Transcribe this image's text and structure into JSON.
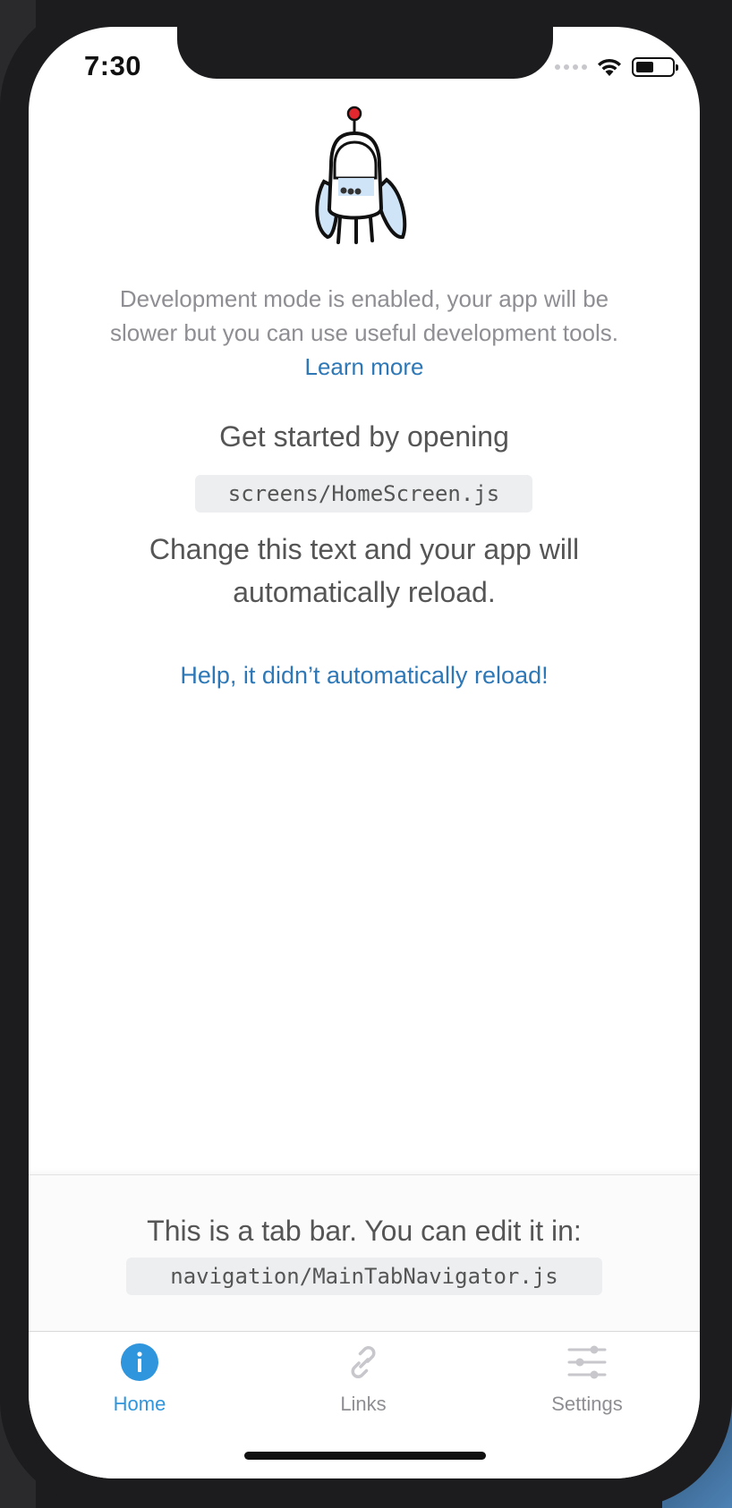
{
  "status_bar": {
    "time": "7:30",
    "signal_icon": "signal-dots-icon",
    "wifi_icon": "wifi-icon",
    "battery_icon": "battery-icon",
    "battery_level": 0.5
  },
  "main": {
    "logo_icon": "robot-icon",
    "dev_text": "Development mode is enabled, your app will be slower but you can use useful development tools.",
    "learn_more": "Learn more",
    "get_started": "Get started by opening",
    "file_path": "screens/HomeScreen.js",
    "change_text": "Change this text and your app will automatically reload.",
    "help_link": "Help, it didn’t automatically reload!"
  },
  "info_panel": {
    "text": "This is a tab bar. You can edit it in:",
    "code": "navigation/MainTabNavigator.js"
  },
  "tabs": [
    {
      "label": "Home",
      "icon": "info-icon",
      "active": true
    },
    {
      "label": "Links",
      "icon": "link-icon",
      "active": false
    },
    {
      "label": "Settings",
      "icon": "settings-sliders-icon",
      "active": false
    }
  ],
  "colors": {
    "accent": "#2f95dc",
    "link": "#2e78b7",
    "inactive": "#8e8e93",
    "text": "#555555"
  }
}
